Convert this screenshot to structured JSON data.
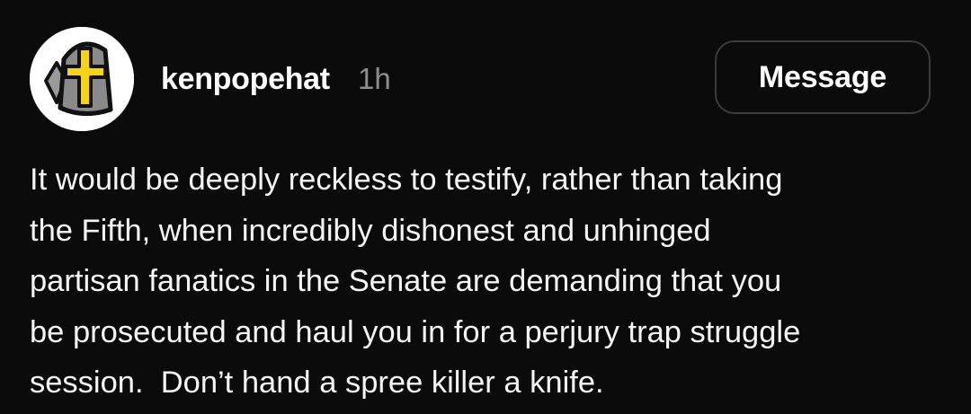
{
  "post": {
    "username": "kenpopehat",
    "timestamp": "1h",
    "message_button_label": "Message",
    "avatar_icon": "mitre-with-cross-icon",
    "body_lines": [
      "It would be deeply reckless to testify, rather than taking",
      "the Fifth, when incredibly dishonest and unhinged",
      "partisan fanatics in the Senate are demanding that you",
      "be prosecuted and haul you in for a perjury trap struggle",
      "session.  Don’t hand a spree killer a knife."
    ]
  },
  "colors": {
    "background": "#0b0b0b",
    "text": "#f5f5f5",
    "timestamp": "#8e8e8e",
    "button_border": "#3c3c3c",
    "avatar_mitre_gray": "#8a8a8a",
    "avatar_cross_yellow": "#f5d31a"
  }
}
